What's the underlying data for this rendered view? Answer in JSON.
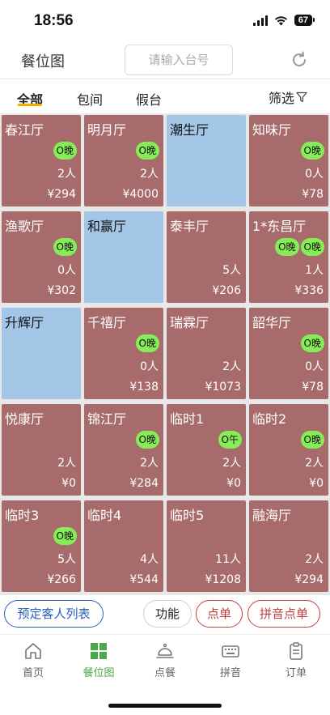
{
  "status": {
    "time": "18:56",
    "battery": "67"
  },
  "header": {
    "title": "餐位图",
    "search_placeholder": "请输入台号"
  },
  "tabs": {
    "all": "全部",
    "private": "包间",
    "fake": "假台",
    "filter": "筛选"
  },
  "tables": [
    {
      "name": "春江厅",
      "tags": [
        "O晚"
      ],
      "people": "2人",
      "amount": "¥294",
      "status": "occupied"
    },
    {
      "name": "明月厅",
      "tags": [
        "O晚"
      ],
      "people": "2人",
      "amount": "¥4000",
      "status": "occupied"
    },
    {
      "name": "潮生厅",
      "tags": [],
      "people": "",
      "amount": "",
      "status": "free"
    },
    {
      "name": "知味厅",
      "tags": [
        "O晚"
      ],
      "people": "0人",
      "amount": "¥78",
      "status": "occupied"
    },
    {
      "name": "渔歌厅",
      "tags": [
        "O晚"
      ],
      "people": "0人",
      "amount": "¥302",
      "status": "occupied"
    },
    {
      "name": "和赢厅",
      "tags": [],
      "people": "",
      "amount": "",
      "status": "free"
    },
    {
      "name": "泰丰厅",
      "tags": [],
      "people": "5人",
      "amount": "¥206",
      "status": "occupied"
    },
    {
      "name": "1*东昌厅",
      "tags": [
        "O晚",
        "O晚"
      ],
      "people": "1人",
      "amount": "¥336",
      "status": "occupied"
    },
    {
      "name": "升辉厅",
      "tags": [],
      "people": "",
      "amount": "",
      "status": "free"
    },
    {
      "name": "千禧厅",
      "tags": [
        "O晚"
      ],
      "people": "0人",
      "amount": "¥138",
      "status": "occupied"
    },
    {
      "name": "瑞霖厅",
      "tags": [],
      "people": "2人",
      "amount": "¥1073",
      "status": "occupied"
    },
    {
      "name": "韶华厅",
      "tags": [
        "O晚"
      ],
      "people": "0人",
      "amount": "¥78",
      "status": "occupied"
    },
    {
      "name": "悦康厅",
      "tags": [],
      "people": "2人",
      "amount": "¥0",
      "status": "occupied"
    },
    {
      "name": "锦江厅",
      "tags": [
        "O晚"
      ],
      "people": "2人",
      "amount": "¥284",
      "status": "occupied"
    },
    {
      "name": "临时1",
      "tags": [
        "O午"
      ],
      "people": "2人",
      "amount": "¥0",
      "status": "occupied"
    },
    {
      "name": "临时2",
      "tags": [
        "O晚"
      ],
      "people": "2人",
      "amount": "¥0",
      "status": "occupied"
    },
    {
      "name": "临时3",
      "tags": [
        "O晚"
      ],
      "people": "5人",
      "amount": "¥266",
      "status": "occupied"
    },
    {
      "name": "临时4",
      "tags": [],
      "people": "4人",
      "amount": "¥544",
      "status": "occupied"
    },
    {
      "name": "临时5",
      "tags": [],
      "people": "11人",
      "amount": "¥1208",
      "status": "occupied"
    },
    {
      "name": "融海厅",
      "tags": [],
      "people": "2人",
      "amount": "¥294",
      "status": "occupied"
    }
  ],
  "actions": {
    "reserve": "预定客人列表",
    "func": "功能",
    "order": "点单",
    "pinyin_order": "拼音点单"
  },
  "nav": {
    "home": "首页",
    "seat_map": "餐位图",
    "ordering": "点餐",
    "pinyin": "拼音",
    "orders": "订单"
  },
  "colors": {
    "occupied": "#a76b6b",
    "free": "#a3c5e6",
    "tag": "#86ec58",
    "active_nav": "#4aa84a",
    "tab_underline": "#f0b000"
  }
}
